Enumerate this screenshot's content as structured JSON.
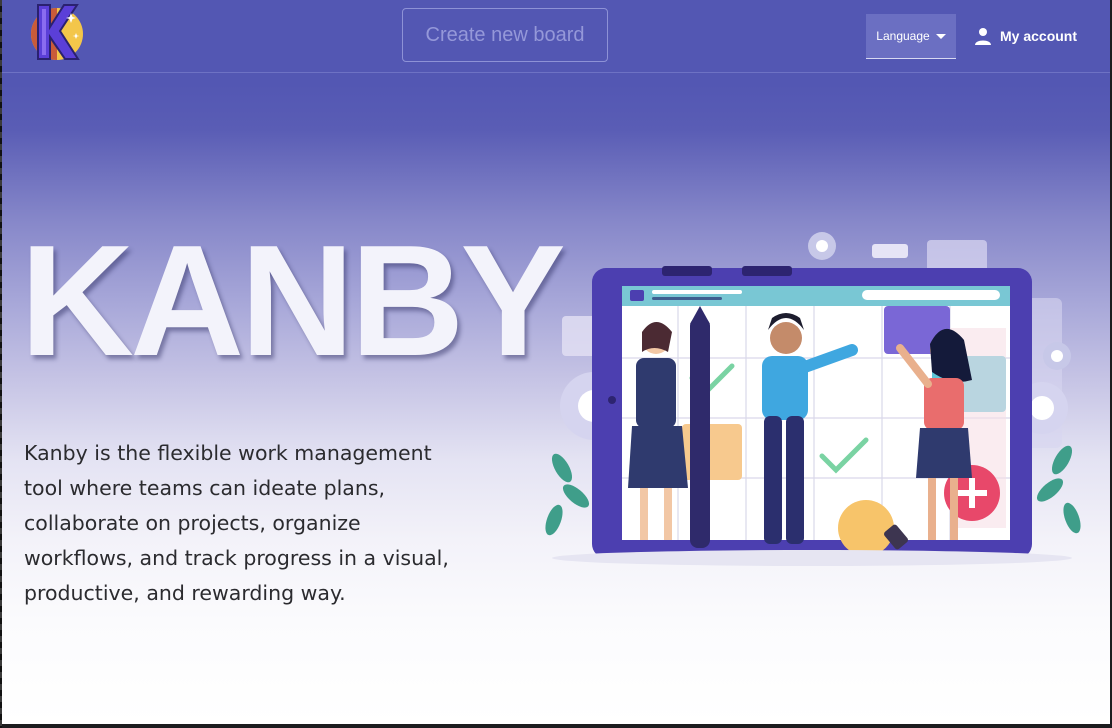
{
  "navbar": {
    "brand": "Kanby",
    "create_board_label": "Create new board",
    "language_label": "Language",
    "account_label": "My account"
  },
  "hero": {
    "title": "KANBY",
    "description": "Kanby is the flexible work management tool where teams can ideate plans, collaborate on projects, organize workflows, and track progress in a visual, productive, and rewarding way."
  },
  "colors": {
    "navbar": "#5357b3",
    "accent": "#4c3fb0",
    "text": "#2b2b2f"
  },
  "icons": {
    "language_caret": "caret-down-icon",
    "account": "user-icon"
  }
}
